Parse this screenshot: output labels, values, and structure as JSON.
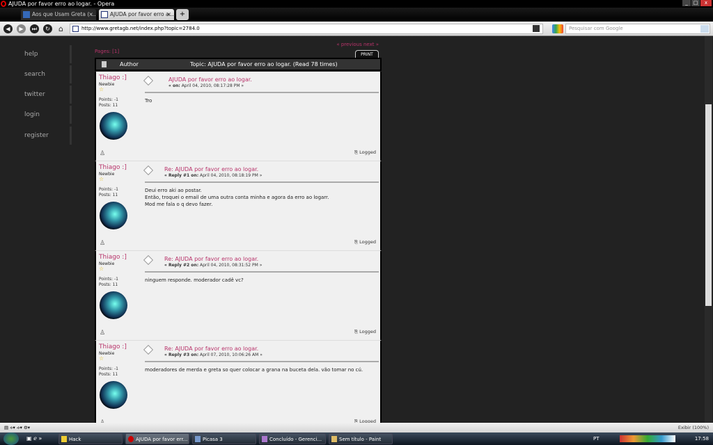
{
  "window": {
    "title": "AJUDA por favor erro ao logar. - Opera"
  },
  "tabs": [
    {
      "label": "Aos que Usam Greta ( ...",
      "close": "×"
    },
    {
      "label": "AJUDA por favor erro a...",
      "close": "×"
    }
  ],
  "toolbar": {
    "url": "http://www.gretagb.net/index.php?topic=2784.0",
    "search_placeholder": "Pesquisar com Google"
  },
  "sidebar": {
    "items": [
      "help",
      "search",
      "twitter",
      "login",
      "register"
    ]
  },
  "forum": {
    "pages": "Pages: [1]",
    "prev_next": "« previous next »",
    "print": "PRINT",
    "author_header": "Author",
    "topic_header": "Topic: AJUDA por favor erro ao logar.  (Read 78 times)"
  },
  "posts": [
    {
      "user": "Thiago :]",
      "rank": "Newbie",
      "points": "Points: -1",
      "posts": "Posts: 11",
      "title": "AJUDA por favor erro ao logar.",
      "date_label": "« on:",
      "date": "April 04, 2010, 08:17:28 PM »",
      "body": "Tro",
      "logged": "Logged"
    },
    {
      "user": "Thiago :]",
      "rank": "Newbie",
      "points": "Points: -1",
      "posts": "Posts: 11",
      "title": "Re: AJUDA por favor erro ao logar.",
      "date_label": "« Reply #1 on:",
      "date": "April 04, 2010, 08:18:19 PM »",
      "body": "Deui erro aki ao postar.\nEntão, troquei o email de uma outra conta minha e agora da erro ao logarr.\nMod me fala o q devo fazer.",
      "logged": "Logged"
    },
    {
      "user": "Thiago :]",
      "rank": "Newbie",
      "points": "Points: -1",
      "posts": "Posts: 11",
      "title": "Re: AJUDA por favor erro ao logar.",
      "date_label": "« Reply #2 on:",
      "date": "April 04, 2010, 08:31:52 PM »",
      "body": "ninguem responde. moderador cadê vc?",
      "logged": "Logged"
    },
    {
      "user": "Thiago :]",
      "rank": "Newbie",
      "points": "Points: -1",
      "posts": "Posts: 11",
      "title": "Re: AJUDA por favor erro ao logar.",
      "date_label": "« Reply #3 on:",
      "date": "April 07, 2010, 10:06:26 AM »",
      "body": "moderadores de merda e greta so quer colocar a grana na buceta dela. vão tomar no cú.",
      "logged": "Logged"
    }
  ],
  "status": {
    "zoom": "Exibir (100%)"
  },
  "taskbar": {
    "items": [
      "Hack",
      "AJUDA por favor err...",
      "Picasa 3",
      "Concluído - Gerenci...",
      "Sem título - Paint"
    ],
    "lang": "PT",
    "clock": "17:58"
  }
}
